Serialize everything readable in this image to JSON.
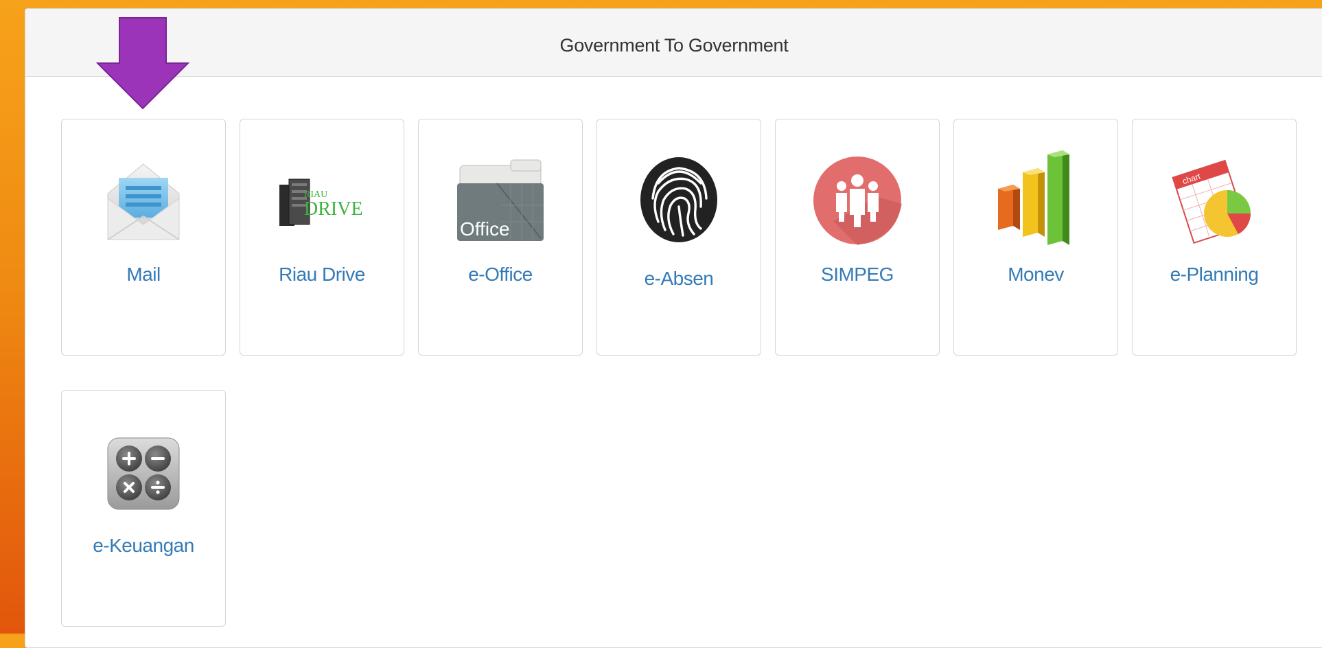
{
  "panel": {
    "title": "Government To Government"
  },
  "apps": [
    {
      "label": "Mail",
      "icon": "mail-icon"
    },
    {
      "label": "Riau Drive",
      "icon": "riau-drive-icon",
      "icon_text_top": "RIAU",
      "icon_text_main": "DRIVE"
    },
    {
      "label": "e-Office",
      "icon": "folder-icon",
      "icon_text": "Office"
    },
    {
      "label": "e-Absen",
      "icon": "fingerprint-icon"
    },
    {
      "label": "SIMPEG",
      "icon": "people-icon"
    },
    {
      "label": "Monev",
      "icon": "bar-chart-icon"
    },
    {
      "label": "e-Planning",
      "icon": "pie-chart-icon",
      "icon_text": "chart"
    },
    {
      "label": "e-Keuangan",
      "icon": "calculator-icon"
    }
  ],
  "annotation": {
    "icon": "arrow-down-icon",
    "color": "#9b34b8"
  },
  "colors": {
    "link": "#337ab7",
    "header_bg": "#f5f5f5",
    "background": "#f39a19"
  }
}
